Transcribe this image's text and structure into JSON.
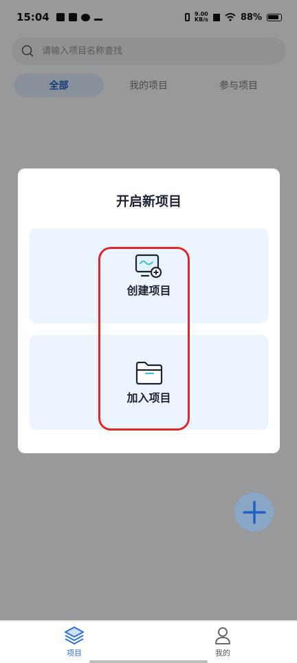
{
  "status_bar": {
    "time": "15:04",
    "net_speed_value": "9.00",
    "net_speed_unit": "KB/s",
    "battery": "88%"
  },
  "search": {
    "placeholder": "请输入项目名称查找"
  },
  "tabs": [
    {
      "label": "全部",
      "active": true
    },
    {
      "label": "我的项目",
      "active": false
    },
    {
      "label": "参与项目",
      "active": false
    }
  ],
  "modal": {
    "title": "开启新项目",
    "options": [
      {
        "label": "创建项目",
        "icon": "monitor-add-icon"
      },
      {
        "label": "加入项目",
        "icon": "folder-open-icon"
      }
    ]
  },
  "fab": {
    "icon": "plus-icon"
  },
  "bottom_nav": [
    {
      "label": "项目",
      "icon": "layers-icon",
      "active": true
    },
    {
      "label": "我的",
      "icon": "user-icon",
      "active": false
    }
  ],
  "colors": {
    "accent": "#2c6fd6",
    "highlight": "#e0262b",
    "card_bg": "#ecf5fd"
  }
}
